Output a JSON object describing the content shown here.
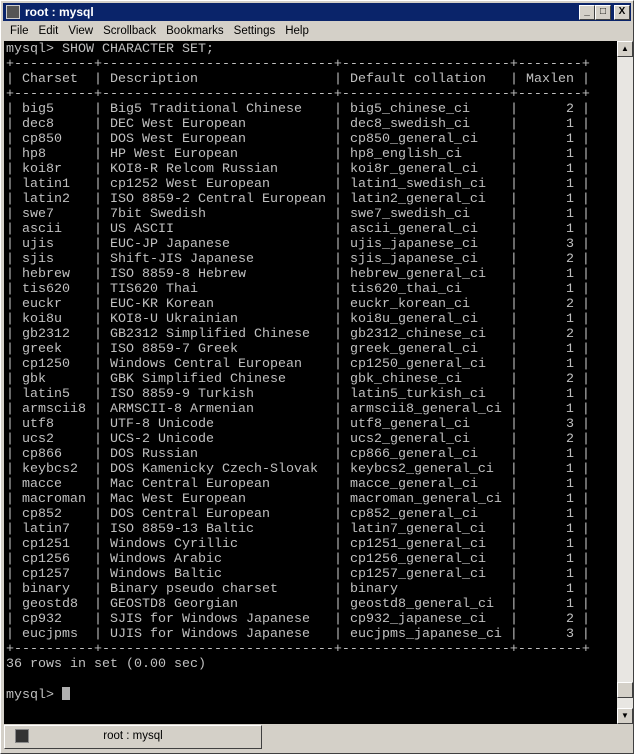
{
  "window": {
    "title": "root : mysql",
    "buttons": {
      "minimize": "_",
      "maximize": "□",
      "close": "X"
    }
  },
  "menu": [
    "File",
    "Edit",
    "View",
    "Scrollback",
    "Bookmarks",
    "Settings",
    "Help"
  ],
  "terminal": {
    "command": "mysql> SHOW CHARACTER SET;",
    "columns": [
      "Charset",
      "Description",
      "Default collation",
      "Maxlen"
    ],
    "rows": [
      [
        "big5",
        "Big5 Traditional Chinese",
        "big5_chinese_ci",
        "2"
      ],
      [
        "dec8",
        "DEC West European",
        "dec8_swedish_ci",
        "1"
      ],
      [
        "cp850",
        "DOS West European",
        "cp850_general_ci",
        "1"
      ],
      [
        "hp8",
        "HP West European",
        "hp8_english_ci",
        "1"
      ],
      [
        "koi8r",
        "KOI8-R Relcom Russian",
        "koi8r_general_ci",
        "1"
      ],
      [
        "latin1",
        "cp1252 West European",
        "latin1_swedish_ci",
        "1"
      ],
      [
        "latin2",
        "ISO 8859-2 Central European",
        "latin2_general_ci",
        "1"
      ],
      [
        "swe7",
        "7bit Swedish",
        "swe7_swedish_ci",
        "1"
      ],
      [
        "ascii",
        "US ASCII",
        "ascii_general_ci",
        "1"
      ],
      [
        "ujis",
        "EUC-JP Japanese",
        "ujis_japanese_ci",
        "3"
      ],
      [
        "sjis",
        "Shift-JIS Japanese",
        "sjis_japanese_ci",
        "2"
      ],
      [
        "hebrew",
        "ISO 8859-8 Hebrew",
        "hebrew_general_ci",
        "1"
      ],
      [
        "tis620",
        "TIS620 Thai",
        "tis620_thai_ci",
        "1"
      ],
      [
        "euckr",
        "EUC-KR Korean",
        "euckr_korean_ci",
        "2"
      ],
      [
        "koi8u",
        "KOI8-U Ukrainian",
        "koi8u_general_ci",
        "1"
      ],
      [
        "gb2312",
        "GB2312 Simplified Chinese",
        "gb2312_chinese_ci",
        "2"
      ],
      [
        "greek",
        "ISO 8859-7 Greek",
        "greek_general_ci",
        "1"
      ],
      [
        "cp1250",
        "Windows Central European",
        "cp1250_general_ci",
        "1"
      ],
      [
        "gbk",
        "GBK Simplified Chinese",
        "gbk_chinese_ci",
        "2"
      ],
      [
        "latin5",
        "ISO 8859-9 Turkish",
        "latin5_turkish_ci",
        "1"
      ],
      [
        "armscii8",
        "ARMSCII-8 Armenian",
        "armscii8_general_ci",
        "1"
      ],
      [
        "utf8",
        "UTF-8 Unicode",
        "utf8_general_ci",
        "3"
      ],
      [
        "ucs2",
        "UCS-2 Unicode",
        "ucs2_general_ci",
        "2"
      ],
      [
        "cp866",
        "DOS Russian",
        "cp866_general_ci",
        "1"
      ],
      [
        "keybcs2",
        "DOS Kamenicky Czech-Slovak",
        "keybcs2_general_ci",
        "1"
      ],
      [
        "macce",
        "Mac Central European",
        "macce_general_ci",
        "1"
      ],
      [
        "macroman",
        "Mac West European",
        "macroman_general_ci",
        "1"
      ],
      [
        "cp852",
        "DOS Central European",
        "cp852_general_ci",
        "1"
      ],
      [
        "latin7",
        "ISO 8859-13 Baltic",
        "latin7_general_ci",
        "1"
      ],
      [
        "cp1251",
        "Windows Cyrillic",
        "cp1251_general_ci",
        "1"
      ],
      [
        "cp1256",
        "Windows Arabic",
        "cp1256_general_ci",
        "1"
      ],
      [
        "cp1257",
        "Windows Baltic",
        "cp1257_general_ci",
        "1"
      ],
      [
        "binary",
        "Binary pseudo charset",
        "binary",
        "1"
      ],
      [
        "geostd8",
        "GEOSTD8 Georgian",
        "geostd8_general_ci",
        "1"
      ],
      [
        "cp932",
        "SJIS for Windows Japanese",
        "cp932_japanese_ci",
        "2"
      ],
      [
        "eucjpms",
        "UJIS for Windows Japanese",
        "eucjpms_japanese_ci",
        "3"
      ]
    ],
    "summary": "36 rows in set (0.00 sec)",
    "prompt": "mysql> "
  },
  "tabs": [
    {
      "label": "root : mysql",
      "icon": "terminal-icon"
    }
  ],
  "colors": {
    "title_bar": "#0a246a",
    "terminal_bg": "#000000",
    "terminal_fg": "#c0c0c0"
  }
}
